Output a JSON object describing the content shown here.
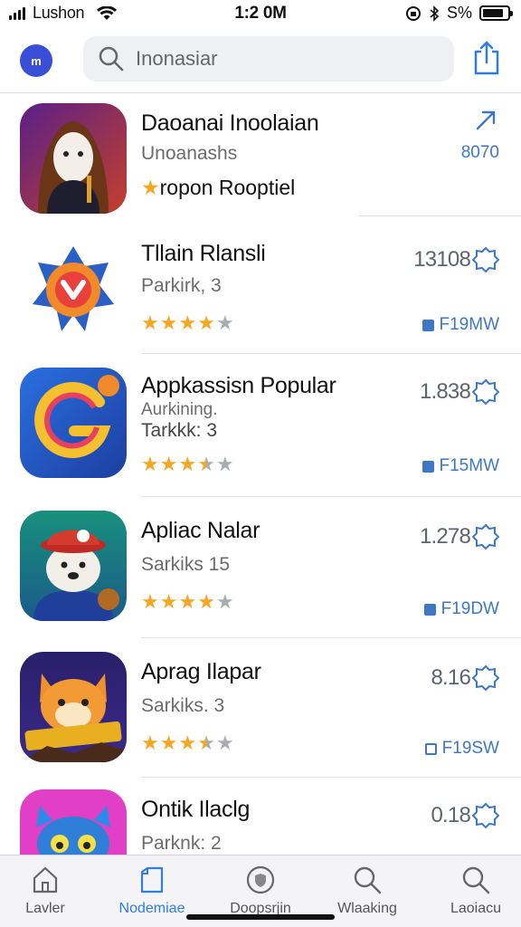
{
  "status": {
    "carrier": "Lushon",
    "time": "1:2 0M",
    "battery_text": "S%",
    "battery_level": 0.85
  },
  "header": {
    "badge": "m",
    "search_value": "Inonasiar",
    "search_placeholder": "Inonasiar"
  },
  "apps": [
    {
      "name": "Daoanai Inoolaian",
      "sub": "Unoanashs",
      "sub2": "",
      "rating_text": "ropon Rooptiel",
      "stars": null,
      "price": "",
      "price_icon": "share-arrow-icon",
      "size": "8070",
      "size_icon": "none",
      "colors": [
        "#6a2a8f",
        "#b5362e"
      ]
    },
    {
      "name": "Tllain Rlansli",
      "sub": "Parkirk, 3",
      "sub2": "",
      "rating_text": "",
      "stars": 4,
      "price": "13108",
      "price_icon": "badge-icon",
      "size": "F19MW",
      "size_icon": "filled",
      "colors": [
        "#e84b2a",
        "#2a6fd6"
      ]
    },
    {
      "name": "Appkassisn Popular",
      "sub": "Aurkining.",
      "sub2": "Tarkkk: 3",
      "rating_text": "",
      "stars": 3.5,
      "price": "1.838",
      "price_icon": "badge-icon",
      "size": "F15MW",
      "size_icon": "filled",
      "colors": [
        "#2a5fd6",
        "#e8403a"
      ]
    },
    {
      "name": "Apliac Nalar",
      "sub": "Sarkiks 15",
      "sub2": "",
      "rating_text": "",
      "stars": 4,
      "price": "1.278",
      "price_icon": "badge-icon",
      "size": "F19DW",
      "size_icon": "filled",
      "colors": [
        "#1a8a7a",
        "#1f4fa8"
      ]
    },
    {
      "name": "Aprag Ilapar",
      "sub": "Sarkiks. 3",
      "sub2": "",
      "rating_text": "",
      "stars": 3.5,
      "price": "8.16",
      "price_icon": "badge-icon",
      "size": "F19SW",
      "size_icon": "outline",
      "colors": [
        "#2b1f6a",
        "#f08a2a"
      ]
    },
    {
      "name": "Ontik Ilaclg",
      "sub": "Parknk: 2",
      "sub2": "",
      "rating_text": "",
      "stars": null,
      "price": "0.18",
      "price_icon": "badge-icon",
      "size": "",
      "size_icon": "none",
      "colors": [
        "#e23fc8",
        "#2a8be8"
      ]
    }
  ],
  "tabs": [
    {
      "label": "Lavler",
      "icon": "home-icon",
      "active": false
    },
    {
      "label": "Nodemiae",
      "icon": "bookmark-icon",
      "active": true
    },
    {
      "label": "Doopsrjin",
      "icon": "shield-icon",
      "active": false
    },
    {
      "label": "Wlaaking",
      "icon": "search-icon",
      "active": false
    },
    {
      "label": "Laoiacu",
      "icon": "search-icon",
      "active": false
    }
  ],
  "colors": {
    "accent": "#2f7de1",
    "star": "#f5a623",
    "size_text": "#3e78c5"
  }
}
